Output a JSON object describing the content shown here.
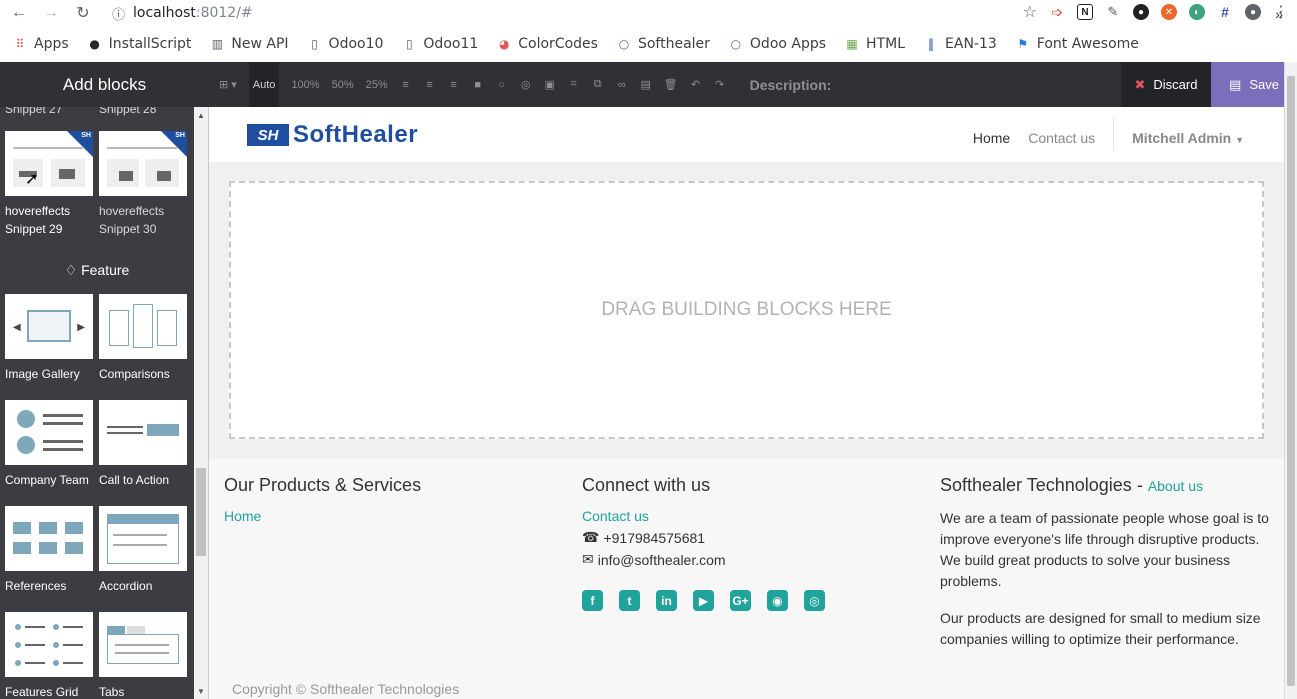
{
  "browser": {
    "url_host": "localhost",
    "url_rest": ":8012/#"
  },
  "bookmarks": [
    {
      "label": "Apps",
      "icon": "apps-grid-icon",
      "color": "#e8453c"
    },
    {
      "label": "InstallScript",
      "icon": "github-icon",
      "color": "#24292e"
    },
    {
      "label": "New API",
      "icon": "book-icon",
      "color": "#5f6368"
    },
    {
      "label": "Odoo10",
      "icon": "page-icon",
      "color": "#5f6368"
    },
    {
      "label": "Odoo11",
      "icon": "page-icon",
      "color": "#5f6368"
    },
    {
      "label": "ColorCodes",
      "icon": "colorwheel-icon",
      "color": "#e2535a"
    },
    {
      "label": "Softhealer",
      "icon": "odoo-icon",
      "color": "#875a7b"
    },
    {
      "label": "Odoo Apps",
      "icon": "odoo-icon",
      "color": "#875a7b"
    },
    {
      "label": "HTML",
      "icon": "html-icon",
      "color": "#6aa84f"
    },
    {
      "label": "EAN-13",
      "icon": "barcode-icon",
      "color": "#1f4e9e"
    },
    {
      "label": "Font Awesome",
      "icon": "flag-icon",
      "color": "#1c7ed6"
    }
  ],
  "editor": {
    "title": "Add blocks",
    "tools": [
      "Auto",
      "100%",
      "50%",
      "25%"
    ],
    "description_label": "Description:",
    "discard_label": "Discard",
    "save_label": "Save"
  },
  "sidebar": {
    "top_labels": [
      "Snippet 27",
      "Snippet 28"
    ],
    "hover_snippets": [
      {
        "line1": "hovereffects",
        "line2": "Snippet 29"
      },
      {
        "line1": "hovereffects",
        "line2": "Snippet 30"
      }
    ],
    "section_title": "Feature",
    "feature_blocks": [
      "Image Gallery",
      "Comparisons",
      "Company Team",
      "Call to Action",
      "References",
      "Accordion",
      "Features Grid",
      "Tabs"
    ]
  },
  "site": {
    "logo_mark": "SH",
    "logo_text": "SoftHealer",
    "nav": {
      "home": "Home",
      "contact": "Contact us",
      "user": "Mitchell Admin"
    },
    "drop_text": "DRAG BUILDING BLOCKS HERE",
    "footer": {
      "col1_title": "Our Products & Services",
      "col1_link": "Home",
      "col2_title": "Connect with us",
      "col2_link": "Contact us",
      "phone": "+917984575681",
      "email": "info@softhealer.com",
      "col3_title": "Softhealer Technologies",
      "col3_dash": " - ",
      "col3_link": "About us",
      "para1": "We are a team of passionate people whose goal is to improve everyone's life through disruptive products. We build great products to solve your business problems.",
      "para2": "Our products are designed for small to medium size companies willing to optimize their performance.",
      "copyright": "Copyright © Softhealer Technologies"
    }
  },
  "colors": {
    "accent": "#1fa39a",
    "brand": "#1f4e9e",
    "save": "#7d6ebb"
  }
}
